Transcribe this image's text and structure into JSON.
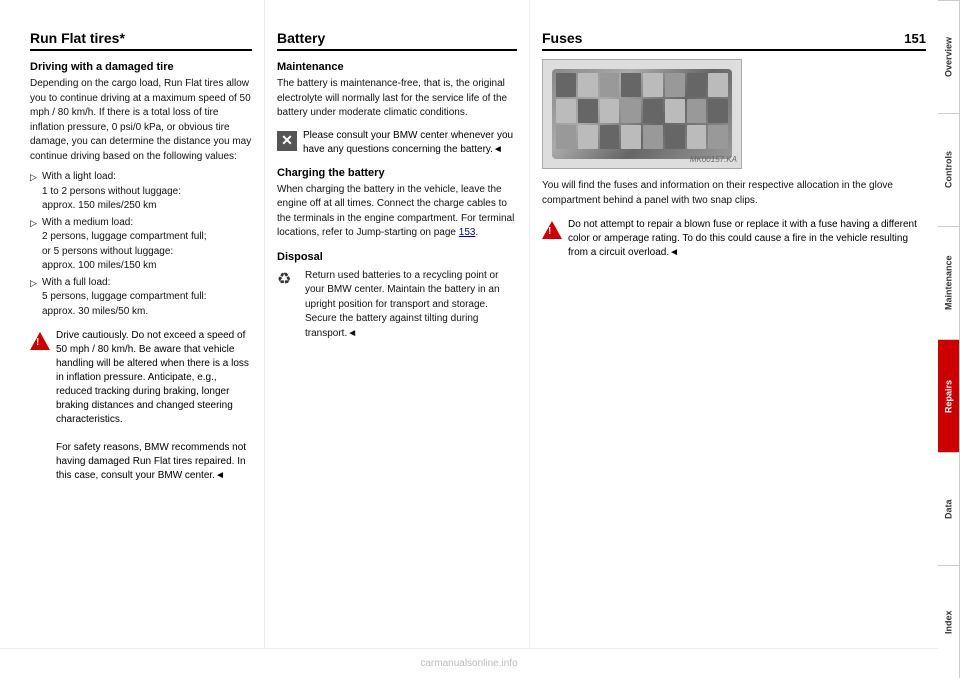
{
  "page": {
    "number": "151"
  },
  "sidebar": {
    "tabs": [
      {
        "label": "Overview",
        "active": false
      },
      {
        "label": "Controls",
        "active": false
      },
      {
        "label": "Maintenance",
        "active": false
      },
      {
        "label": "Repairs",
        "active": true
      },
      {
        "label": "Data",
        "active": false
      },
      {
        "label": "Index",
        "active": false
      }
    ]
  },
  "col_left": {
    "section_title": "Run Flat tires*",
    "subsection1_title": "Driving with a damaged tire",
    "subsection1_body": "Depending on the cargo load, Run Flat tires allow you to continue driving at a maximum speed of 50 mph / 80 km/h. If there is a total loss of tire inflation pressure, 0 psi/0 kPa, or obvious tire damage, you can determine the distance you may continue driving based on the following values:",
    "bullets": [
      {
        "label": "With a light load:",
        "detail": "1 to 2 persons without luggage:\napprox. 150 miles/250 km"
      },
      {
        "label": "With a medium load:",
        "detail": "2 persons, luggage compartment full;\nor 5 persons without luggage:\napprox. 100 miles/150 km"
      },
      {
        "label": "With a full load:",
        "detail": "5 persons, luggage compartment full:\napprox. 30 miles/50 km."
      }
    ],
    "warning_text": "Drive cautiously. Do not exceed a speed of 50 mph / 80 km/h. Be aware that vehicle handling will be altered when there is a loss in inflation pressure. Anticipate, e.g., reduced tracking during braking, longer braking distances and changed steering characteristics.\nFor safety reasons, BMW recommends not having damaged Run Flat tires repaired. In this case, consult your BMW center.◄"
  },
  "col_middle": {
    "section_title": "Battery",
    "subsection1_title": "Maintenance",
    "subsection1_body": "The battery is maintenance-free, that is, the original electrolyte will normally last for the service life of the battery under moderate climatic conditions.",
    "note_text": "Please consult your BMW center whenever you have any questions concerning the battery.◄",
    "subsection2_title": "Charging the battery",
    "subsection2_body": "When charging the battery in the vehicle, leave the engine off at all times. Connect the charge cables to the terminals in the engine compartment. For terminal locations, refer to Jump-starting on page 153.",
    "subsection3_title": "Disposal",
    "disposal_text": "Return used batteries to a recycling point or your BMW center. Maintain the battery in an upright position for transport and storage. Secure the battery against tilting during transport.◄"
  },
  "col_right": {
    "section_title": "Fuses",
    "body_text": "You will find the fuses and information on their respective allocation in the glove compartment behind a panel with two snap clips.",
    "warning_text": "Do not attempt to repair a blown fuse or replace it with a fuse having a different color or amperage rating. To do this could cause a fire in the vehicle resulting from a circuit overload.◄"
  },
  "watermark": "carmanualsonline.info"
}
